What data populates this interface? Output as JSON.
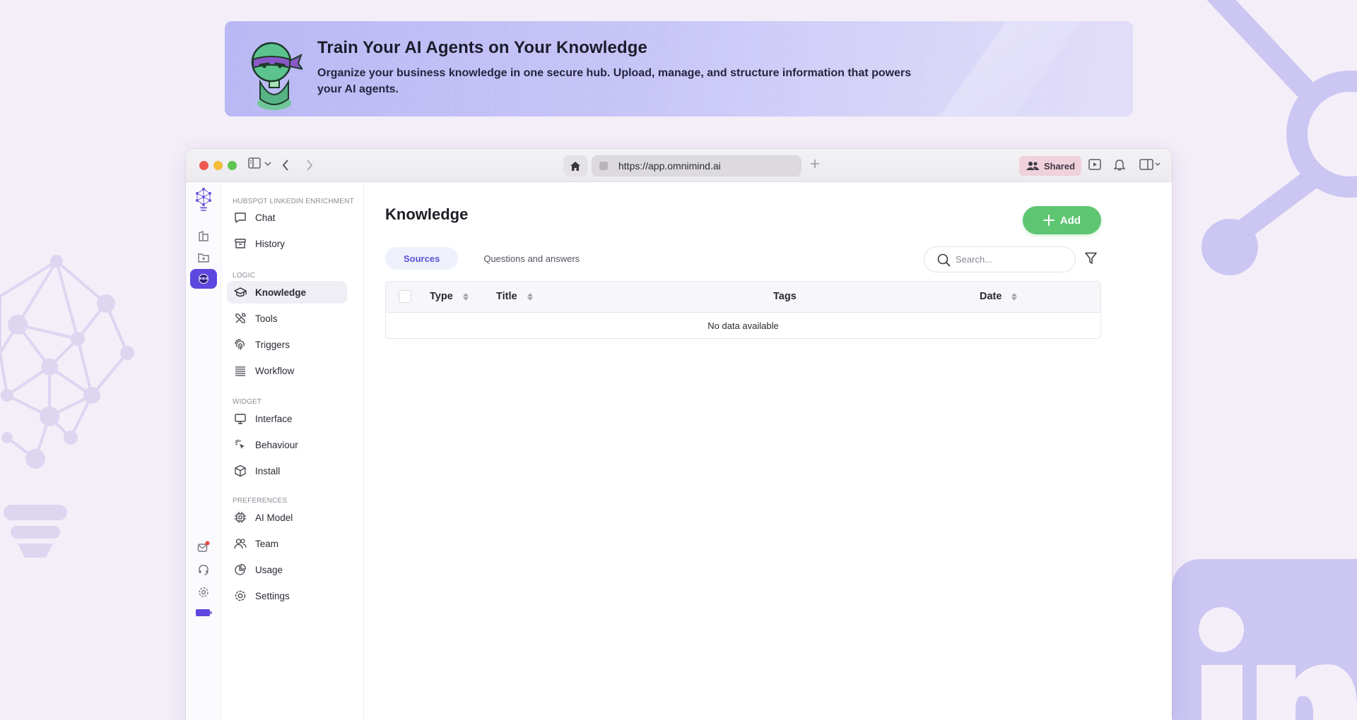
{
  "banner": {
    "title": "Train Your AI Agents on Your Knowledge",
    "subtitle": "Organize your business knowledge in one secure hub. Upload, manage, and structure information that powers your AI agents."
  },
  "browser": {
    "url": "https://app.omnimind.ai",
    "shared_label": "Shared"
  },
  "sidebar": {
    "sections": [
      {
        "label": "HUBSPOT LINKEDIN ENRICHMENT",
        "items": [
          {
            "label": "Chat",
            "icon": "chat-icon"
          },
          {
            "label": "History",
            "icon": "archive-icon"
          }
        ]
      },
      {
        "label": "LOGIC",
        "items": [
          {
            "label": "Knowledge",
            "icon": "graduation-cap-icon",
            "active": true
          },
          {
            "label": "Tools",
            "icon": "tools-icon"
          },
          {
            "label": "Triggers",
            "icon": "fingerprint-icon"
          },
          {
            "label": "Workflow",
            "icon": "workflow-icon"
          }
        ]
      },
      {
        "label": "WIDGET",
        "items": [
          {
            "label": "Interface",
            "icon": "monitor-icon"
          },
          {
            "label": "Behaviour",
            "icon": "sparkle-cursor-icon"
          },
          {
            "label": "Install",
            "icon": "box-icon"
          }
        ]
      },
      {
        "label": "PREFERENCES",
        "items": [
          {
            "label": "AI Model",
            "icon": "chip-icon"
          },
          {
            "label": "Team",
            "icon": "team-icon"
          },
          {
            "label": "Usage",
            "icon": "pie-chart-icon"
          },
          {
            "label": "Settings",
            "icon": "gear-icon"
          }
        ]
      }
    ]
  },
  "main": {
    "title": "Knowledge",
    "add_label": "Add",
    "tabs": [
      {
        "label": "Sources",
        "active": true
      },
      {
        "label": "Questions and answers"
      }
    ],
    "search_placeholder": "Search...",
    "table": {
      "columns": [
        "Type",
        "Title",
        "Tags",
        "Date"
      ],
      "empty_text": "No data available"
    }
  },
  "colors": {
    "accent": "#5d47df",
    "add_button": "#5ec571",
    "active_tab_text": "#5b50d6"
  }
}
